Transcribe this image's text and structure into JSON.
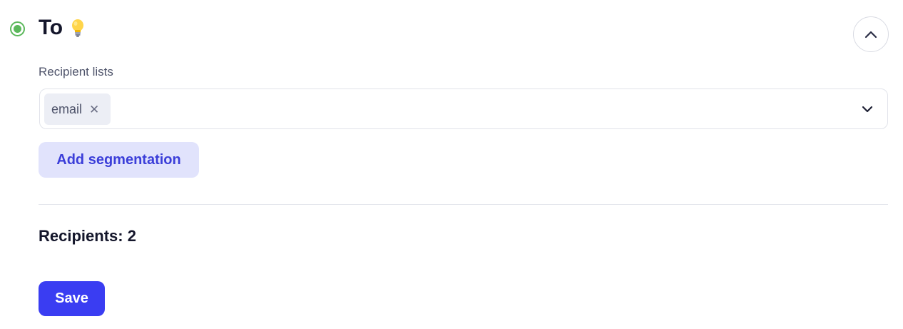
{
  "section": {
    "title": "To",
    "title_icon": "lightbulb-icon",
    "status_icon": "radio-active-icon",
    "status_color": "#5cb85c",
    "collapse_icon": "chevron-up-icon"
  },
  "recipient_lists": {
    "label": "Recipient lists",
    "selected": [
      {
        "label": "email",
        "remove_icon": "close-icon"
      }
    ],
    "dropdown_icon": "chevron-down-icon"
  },
  "actions": {
    "add_segmentation_label": "Add segmentation",
    "save_label": "Save"
  },
  "summary": {
    "recipients_text": "Recipients: 2"
  },
  "colors": {
    "accent": "#3a3df2",
    "accent_soft": "#e1e3fc",
    "status": "#5cb85c"
  }
}
